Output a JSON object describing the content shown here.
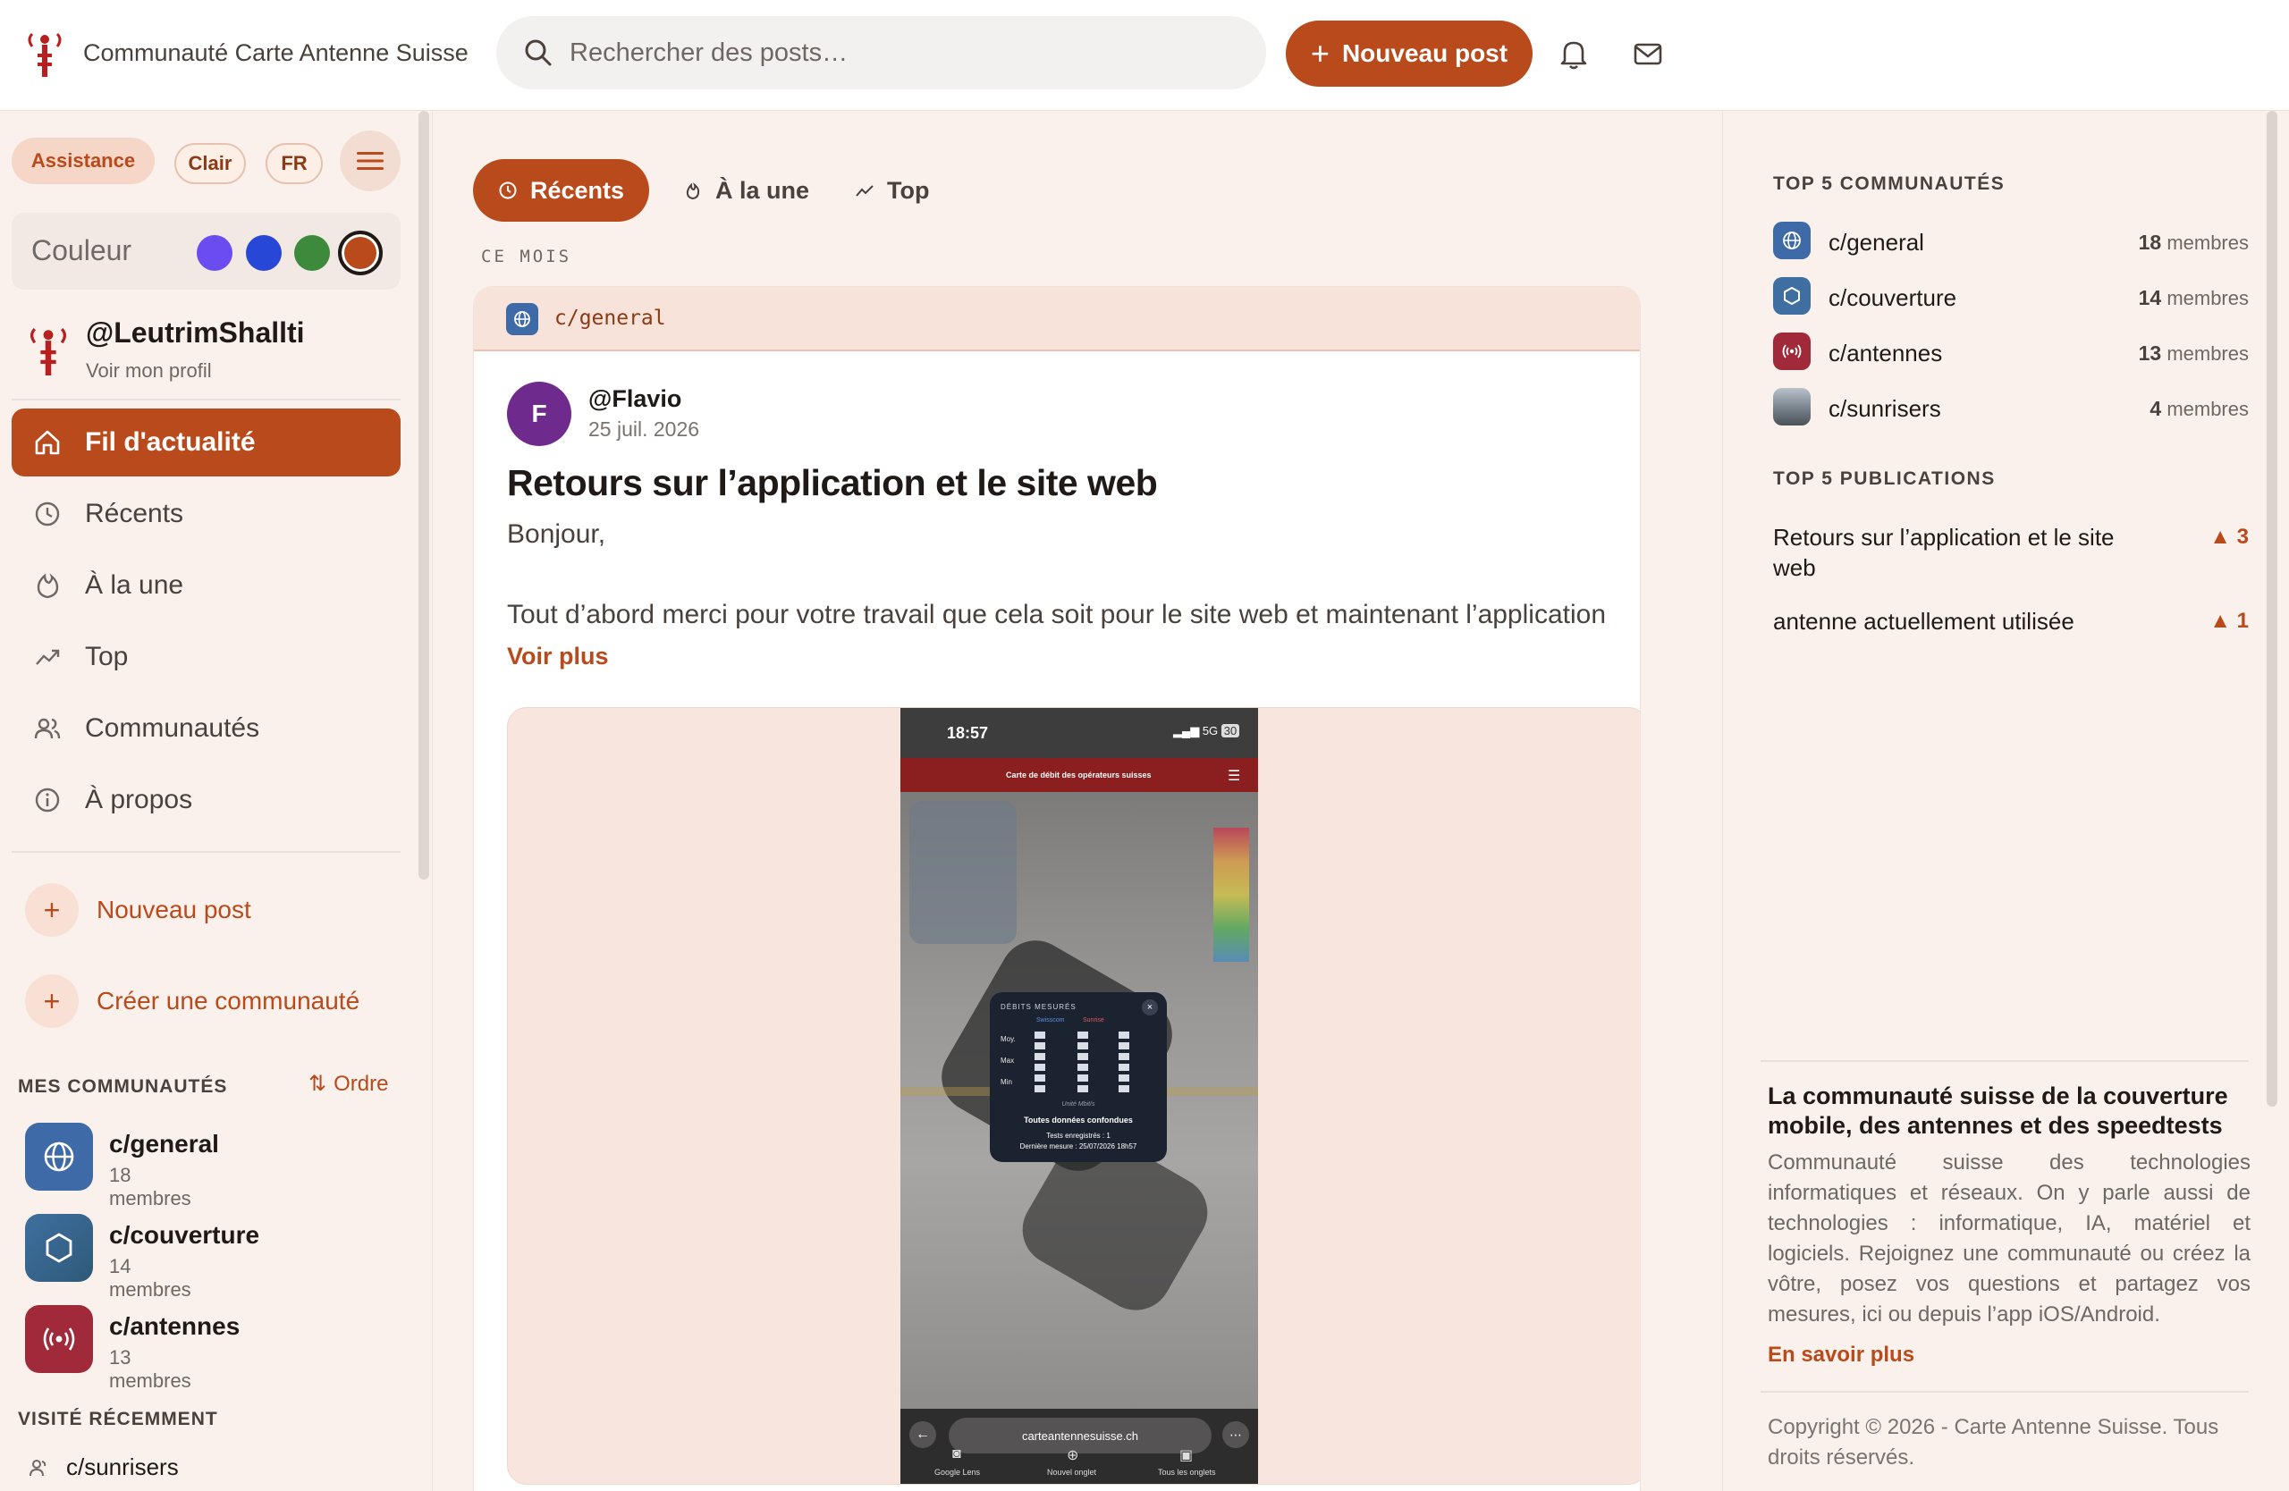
{
  "colors": {
    "accent": "#b84a1c",
    "accent_light": "#f8e3da",
    "bg": "#fbf1ec"
  },
  "header": {
    "site_title": "Communauté Carte Antenne Suisse",
    "search_placeholder": "Rechercher des posts…",
    "new_post_label": "Nouveau post",
    "icons": [
      "antenna-logo",
      "search-icon",
      "bell-icon",
      "mail-icon"
    ]
  },
  "sidebar": {
    "chips": {
      "assist": "Assistance",
      "theme": "Clair",
      "lang": "FR"
    },
    "color_label": "Couleur",
    "swatches": [
      "#6b4cf0",
      "#2747d6",
      "#3d8a3d",
      "#b84a1c"
    ],
    "profile": {
      "handle": "@LeutrimShallti",
      "sub": "Voir mon profil"
    },
    "nav": [
      {
        "label": "Fil d'actualité",
        "icon": "home-icon",
        "active": true
      },
      {
        "label": "Récents",
        "icon": "clock-icon"
      },
      {
        "label": "À la une",
        "icon": "flame-icon"
      },
      {
        "label": "Top",
        "icon": "trending-icon"
      },
      {
        "label": "Communautés",
        "icon": "users-icon"
      },
      {
        "label": "À propos",
        "icon": "info-icon"
      }
    ],
    "actions": {
      "new_post": "Nouveau post",
      "create_community": "Créer une communauté"
    },
    "my_communities_title": "MES COMMUNAUTÉS",
    "order_label": "Ordre",
    "my_communities": [
      {
        "name": "c/general",
        "members": "18 membres"
      },
      {
        "name": "c/couverture",
        "members": "14 membres"
      },
      {
        "name": "c/antennes",
        "members": "13 membres"
      }
    ],
    "recent_title": "VISITÉ RÉCEMMENT",
    "recent": [
      {
        "name": "c/sunrisers"
      }
    ]
  },
  "main": {
    "tabs": [
      {
        "label": "Récents",
        "active": true
      },
      {
        "label": "À la une"
      },
      {
        "label": "Top"
      }
    ],
    "period": "CE MOIS",
    "post": {
      "community": "c/general",
      "author_initial": "F",
      "author": "@Flavio",
      "date": "25 juil. 2026",
      "title": "Retours sur l’application et le site web",
      "greeting": "Bonjour,",
      "excerpt": "Tout d’abord merci pour votre travail que cela soit pour le site web et maintenant l’application",
      "see_more": "Voir plus",
      "screenshot": {
        "time": "18:57",
        "network": "5G",
        "battery": "30",
        "bar_title": "Carte de débit des opérateurs suisses",
        "modal_title": "DÉBITS MESURÉS",
        "modal_cols": [
          "Swisscom",
          "Sunrise"
        ],
        "modal_rows": [
          "Moy.",
          "Max",
          "Min"
        ],
        "unit": "Unité Mbit/s",
        "all_data": "Toutes données confondues",
        "tests": "Tests enregistrés : 1",
        "last": "Dernière mesure : 25/07/2026 18h57",
        "url": "carteantennesuisse.ch",
        "bottom": [
          "Google Lens",
          "Nouvel onglet",
          "Tous les onglets"
        ]
      }
    }
  },
  "right": {
    "top_comm_title": "TOP 5 COMMUNAUTÉS",
    "top_comms": [
      {
        "name": "c/general",
        "count": "18",
        "unit": "membres"
      },
      {
        "name": "c/couverture",
        "count": "14",
        "unit": "membres"
      },
      {
        "name": "c/antennes",
        "count": "13",
        "unit": "membres"
      },
      {
        "name": "c/sunrisers",
        "count": "4",
        "unit": "membres"
      }
    ],
    "top_pub_title": "TOP 5 PUBLICATIONS",
    "top_pubs": [
      {
        "title": "Retours sur l’application et le site web",
        "votes": "▲ 3"
      },
      {
        "title": "antenne actuellement utilisée",
        "votes": "▲ 1"
      }
    ],
    "about_title": "La communauté suisse de la couverture mobile, des antennes et des speedtests",
    "about_text": "Communauté suisse des technologies informatiques et réseaux. On y parle aussi de technologies : informatique, IA, matériel et logiciels. Rejoignez une communauté ou créez la vôtre, posez vos questions et partagez vos mesures, ici ou depuis l’app iOS/Android.",
    "about_link": "En savoir plus",
    "copyright": "Copyright © 2026 - Carte Antenne Suisse. Tous droits réservés."
  }
}
